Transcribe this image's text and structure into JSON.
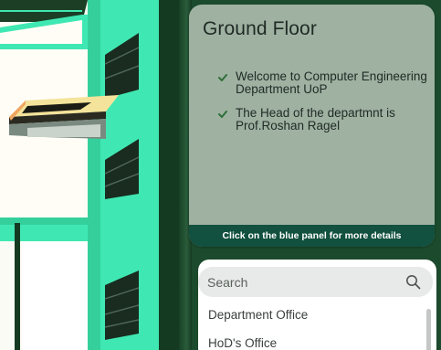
{
  "info_panel": {
    "title": "Ground Floor",
    "items": [
      {
        "text": "Welcome to Computer Engineering Department UoP"
      },
      {
        "text": "The Head of the departmnt is Prof.Roshan Ragel"
      }
    ],
    "footer": "Click on the blue panel for more details"
  },
  "search": {
    "placeholder": "Search",
    "value": "",
    "icon": "search-icon",
    "results": [
      {
        "label": "Department Office"
      },
      {
        "label": "HoD's Office"
      }
    ]
  },
  "colors": {
    "wall_green": "#3fe8b2",
    "building_white": "#fffdf6",
    "floor_yellow": "#f4e39a",
    "floor_orange": "#f0a560",
    "background_green": "#1e4f2f",
    "panel_bg": "#9fb2a2",
    "footer_bg": "#12503f",
    "check_color": "#2f6e3a"
  }
}
